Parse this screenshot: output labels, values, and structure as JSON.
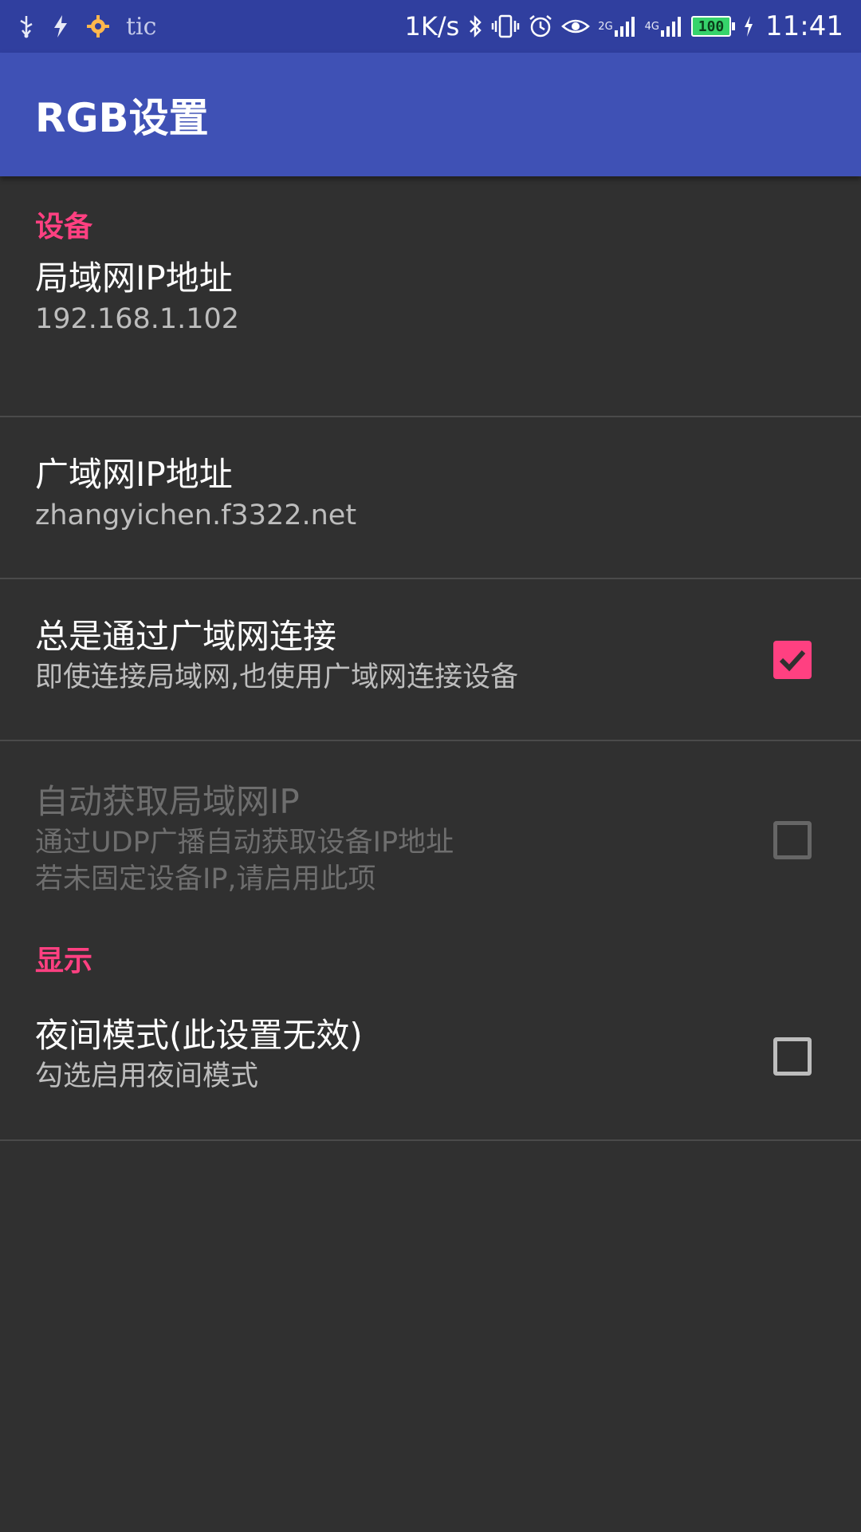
{
  "status_bar": {
    "left_icons": [
      "usb-icon",
      "flash-icon",
      "gear-icon"
    ],
    "app_label": "tic",
    "speed": "1K/s",
    "right_icons": [
      "bluetooth-icon",
      "vibrate-icon",
      "alarm-icon",
      "eye-icon",
      "signal-2g-icon",
      "signal-4g-icon"
    ],
    "net_2g": "2G",
    "net_4g": "4G",
    "battery": "100",
    "time": "11:41"
  },
  "app_bar": {
    "title": "RGB设置"
  },
  "sections": [
    {
      "header": "设备",
      "prefs": [
        {
          "title": "局域网IP地址",
          "summary": "192.168.1.102"
        },
        {
          "title": "广域网IP地址",
          "summary": "zhangyichen.f3322.net"
        },
        {
          "title": "总是通过广域网连接",
          "summary": "即使连接局域网,也使用广域网连接设备",
          "checked": true
        },
        {
          "title": "自动获取局域网IP",
          "summary_line1": "通过UDP广播自动获取设备IP地址",
          "summary_line2": "若未固定设备IP,请启用此项",
          "checked": false,
          "enabled": false
        }
      ]
    },
    {
      "header": "显示",
      "prefs": [
        {
          "title": "夜间模式(此设置无效)",
          "summary": "勾选启用夜间模式",
          "checked": false
        }
      ]
    }
  ],
  "colors": {
    "status_bar": "#303f9f",
    "app_bar": "#3f51b5",
    "accent": "#ff4081",
    "background": "#303030"
  }
}
